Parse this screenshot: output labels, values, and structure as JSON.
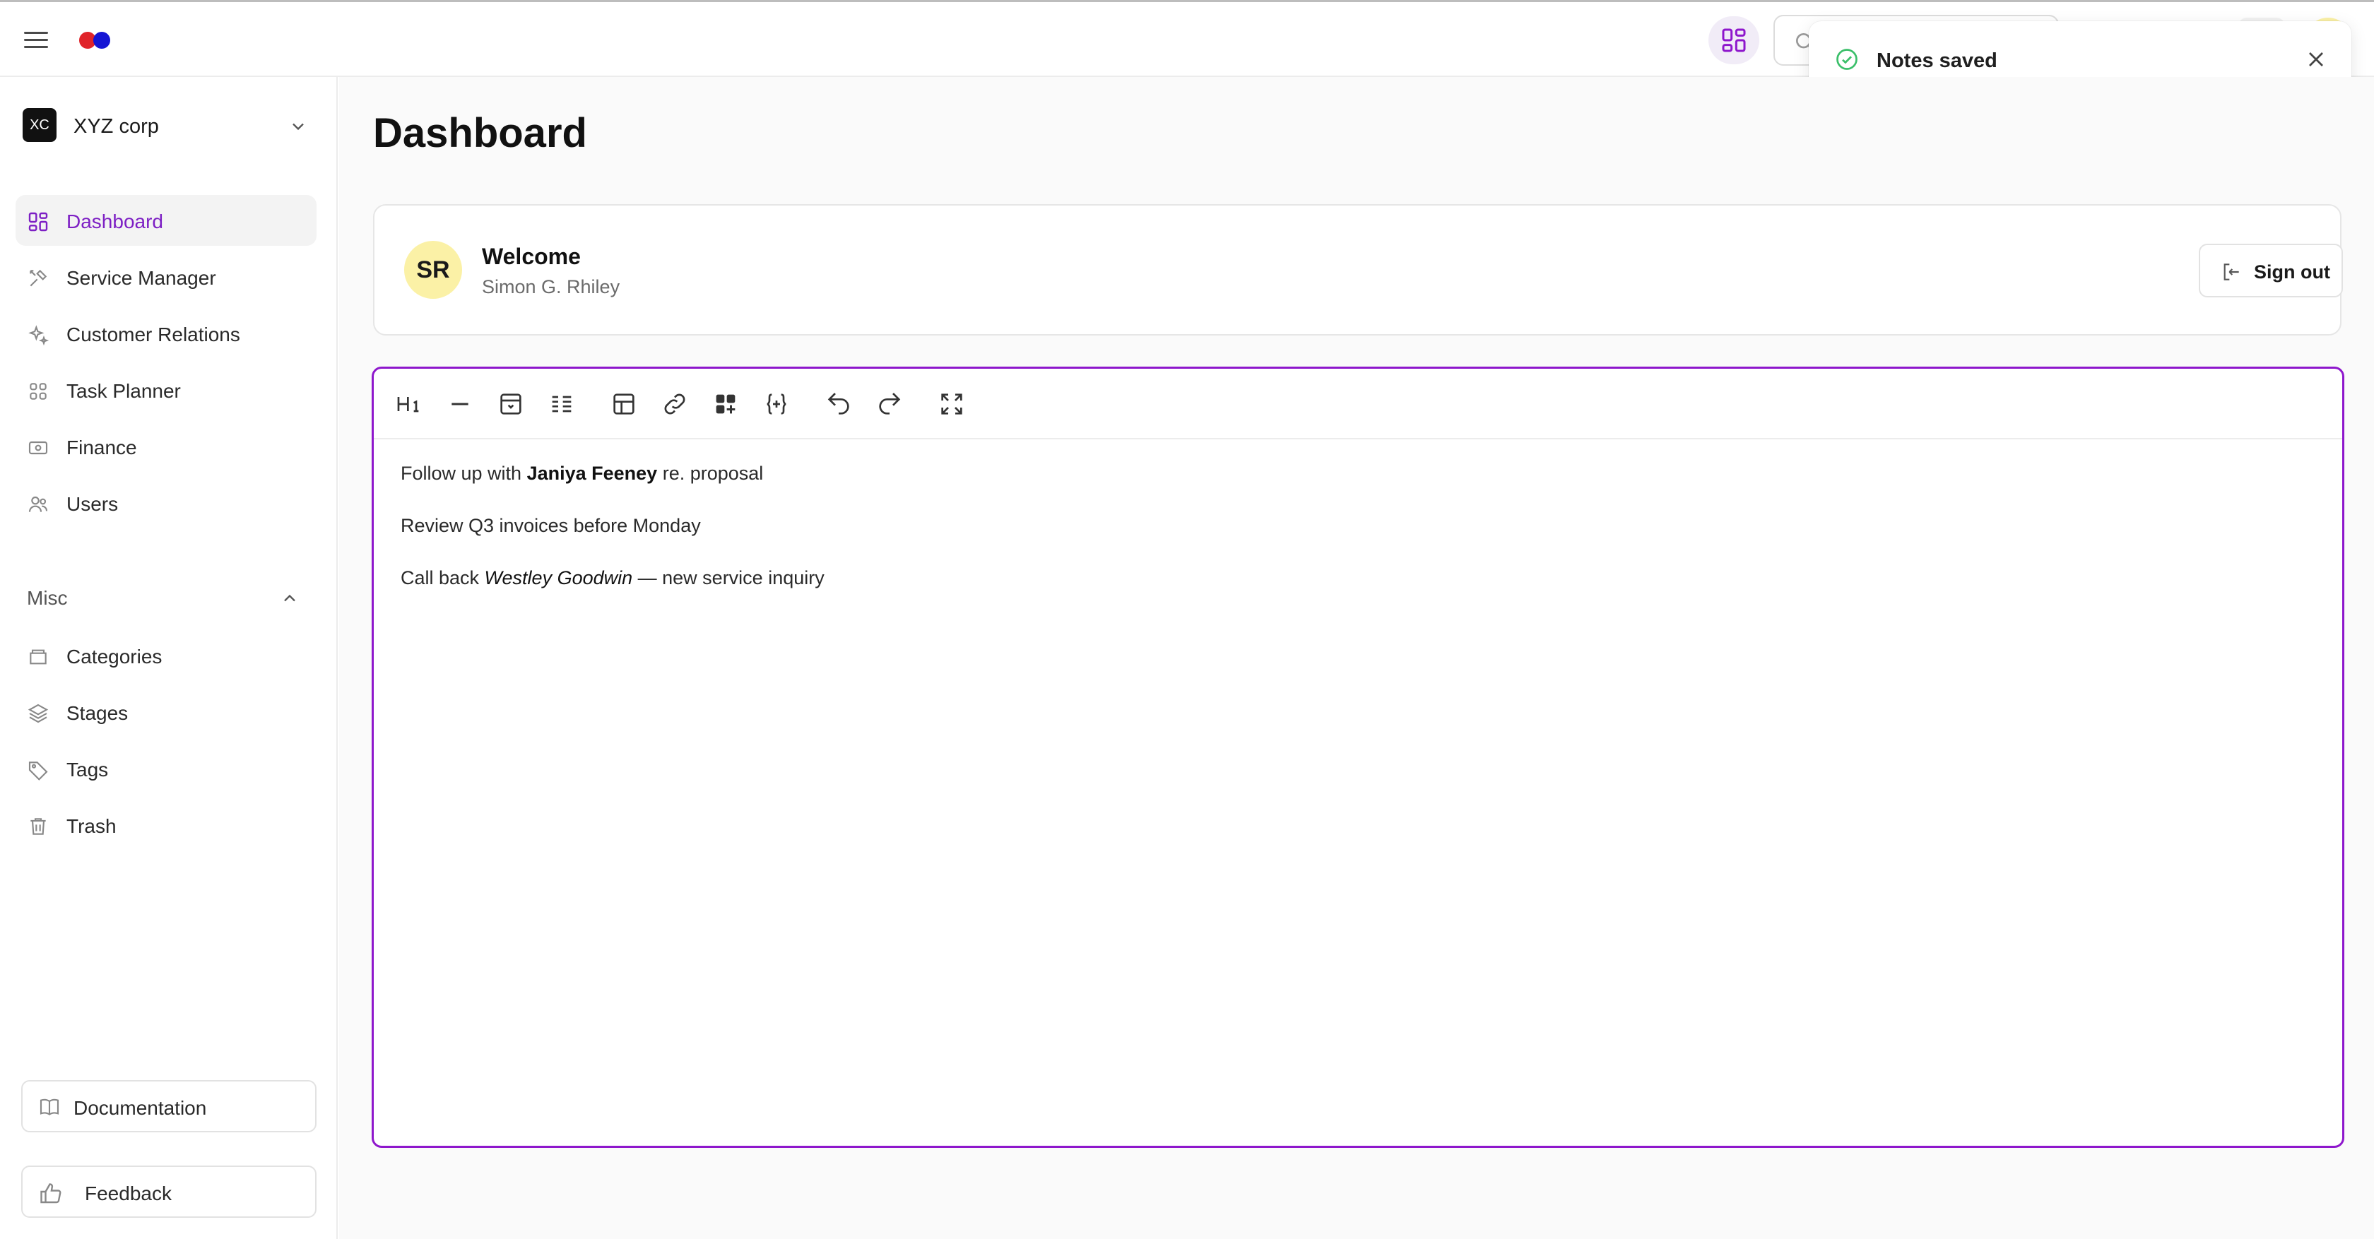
{
  "topbar": {
    "logo_colors": [
      "#e0242a",
      "#1515d4"
    ],
    "accent": "#7d1fc4"
  },
  "toast": {
    "message": "Notes saved",
    "status_color": "#3bbf6a"
  },
  "sidebar": {
    "org": {
      "badge": "XC",
      "name": "XYZ corp"
    },
    "items": [
      {
        "label": "Dashboard",
        "icon": "dashboard-icon",
        "active": true
      },
      {
        "label": "Service Manager",
        "icon": "tools-icon"
      },
      {
        "label": "Customer Relations",
        "icon": "sparkle-icon"
      },
      {
        "label": "Task Planner",
        "icon": "grid-icon"
      },
      {
        "label": "Finance",
        "icon": "money-icon"
      },
      {
        "label": "Users",
        "icon": "users-icon"
      }
    ],
    "misc_label": "Misc",
    "misc_items": [
      {
        "label": "Categories",
        "icon": "folder-icon"
      },
      {
        "label": "Stages",
        "icon": "layers-icon"
      },
      {
        "label": "Tags",
        "icon": "tag-icon"
      },
      {
        "label": "Trash",
        "icon": "trash-icon"
      }
    ],
    "documentation_label": "Documentation",
    "feedback_label": "Feedback"
  },
  "main": {
    "title": "Dashboard",
    "welcome": {
      "avatar_initials": "SR",
      "title": "Welcome",
      "name": "Simon G. Rhiley",
      "signout_label": "Sign out"
    },
    "editor": {
      "toolbar": [
        "heading-icon",
        "horizontal-rule-icon",
        "archive-icon",
        "list-icon",
        "table-icon",
        "link-icon",
        "add-block-icon",
        "variable-icon",
        "undo-icon",
        "redo-icon",
        "fullscreen-icon"
      ],
      "lines": [
        {
          "before": "Follow up with ",
          "emph": "Janiya Feeney",
          "style": "bold",
          "after": " re. proposal"
        },
        {
          "before": "Review Q3 invoices before Monday",
          "emph": "",
          "style": "none",
          "after": ""
        },
        {
          "before": "Call back ",
          "emph": "Westley Goodwin",
          "style": "italic",
          "after": " — new service inquiry"
        }
      ]
    }
  }
}
